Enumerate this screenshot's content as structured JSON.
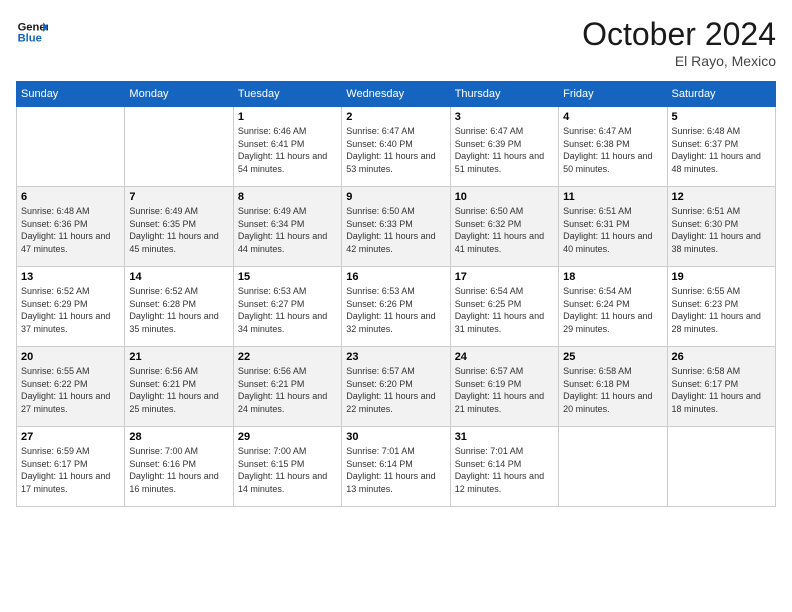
{
  "header": {
    "logo_line1": "General",
    "logo_line2": "Blue",
    "month": "October 2024",
    "location": "El Rayo, Mexico"
  },
  "weekdays": [
    "Sunday",
    "Monday",
    "Tuesday",
    "Wednesday",
    "Thursday",
    "Friday",
    "Saturday"
  ],
  "weeks": [
    [
      {
        "day": "",
        "info": ""
      },
      {
        "day": "",
        "info": ""
      },
      {
        "day": "1",
        "info": "Sunrise: 6:46 AM\nSunset: 6:41 PM\nDaylight: 11 hours and 54 minutes."
      },
      {
        "day": "2",
        "info": "Sunrise: 6:47 AM\nSunset: 6:40 PM\nDaylight: 11 hours and 53 minutes."
      },
      {
        "day": "3",
        "info": "Sunrise: 6:47 AM\nSunset: 6:39 PM\nDaylight: 11 hours and 51 minutes."
      },
      {
        "day": "4",
        "info": "Sunrise: 6:47 AM\nSunset: 6:38 PM\nDaylight: 11 hours and 50 minutes."
      },
      {
        "day": "5",
        "info": "Sunrise: 6:48 AM\nSunset: 6:37 PM\nDaylight: 11 hours and 48 minutes."
      }
    ],
    [
      {
        "day": "6",
        "info": "Sunrise: 6:48 AM\nSunset: 6:36 PM\nDaylight: 11 hours and 47 minutes."
      },
      {
        "day": "7",
        "info": "Sunrise: 6:49 AM\nSunset: 6:35 PM\nDaylight: 11 hours and 45 minutes."
      },
      {
        "day": "8",
        "info": "Sunrise: 6:49 AM\nSunset: 6:34 PM\nDaylight: 11 hours and 44 minutes."
      },
      {
        "day": "9",
        "info": "Sunrise: 6:50 AM\nSunset: 6:33 PM\nDaylight: 11 hours and 42 minutes."
      },
      {
        "day": "10",
        "info": "Sunrise: 6:50 AM\nSunset: 6:32 PM\nDaylight: 11 hours and 41 minutes."
      },
      {
        "day": "11",
        "info": "Sunrise: 6:51 AM\nSunset: 6:31 PM\nDaylight: 11 hours and 40 minutes."
      },
      {
        "day": "12",
        "info": "Sunrise: 6:51 AM\nSunset: 6:30 PM\nDaylight: 11 hours and 38 minutes."
      }
    ],
    [
      {
        "day": "13",
        "info": "Sunrise: 6:52 AM\nSunset: 6:29 PM\nDaylight: 11 hours and 37 minutes."
      },
      {
        "day": "14",
        "info": "Sunrise: 6:52 AM\nSunset: 6:28 PM\nDaylight: 11 hours and 35 minutes."
      },
      {
        "day": "15",
        "info": "Sunrise: 6:53 AM\nSunset: 6:27 PM\nDaylight: 11 hours and 34 minutes."
      },
      {
        "day": "16",
        "info": "Sunrise: 6:53 AM\nSunset: 6:26 PM\nDaylight: 11 hours and 32 minutes."
      },
      {
        "day": "17",
        "info": "Sunrise: 6:54 AM\nSunset: 6:25 PM\nDaylight: 11 hours and 31 minutes."
      },
      {
        "day": "18",
        "info": "Sunrise: 6:54 AM\nSunset: 6:24 PM\nDaylight: 11 hours and 29 minutes."
      },
      {
        "day": "19",
        "info": "Sunrise: 6:55 AM\nSunset: 6:23 PM\nDaylight: 11 hours and 28 minutes."
      }
    ],
    [
      {
        "day": "20",
        "info": "Sunrise: 6:55 AM\nSunset: 6:22 PM\nDaylight: 11 hours and 27 minutes."
      },
      {
        "day": "21",
        "info": "Sunrise: 6:56 AM\nSunset: 6:21 PM\nDaylight: 11 hours and 25 minutes."
      },
      {
        "day": "22",
        "info": "Sunrise: 6:56 AM\nSunset: 6:21 PM\nDaylight: 11 hours and 24 minutes."
      },
      {
        "day": "23",
        "info": "Sunrise: 6:57 AM\nSunset: 6:20 PM\nDaylight: 11 hours and 22 minutes."
      },
      {
        "day": "24",
        "info": "Sunrise: 6:57 AM\nSunset: 6:19 PM\nDaylight: 11 hours and 21 minutes."
      },
      {
        "day": "25",
        "info": "Sunrise: 6:58 AM\nSunset: 6:18 PM\nDaylight: 11 hours and 20 minutes."
      },
      {
        "day": "26",
        "info": "Sunrise: 6:58 AM\nSunset: 6:17 PM\nDaylight: 11 hours and 18 minutes."
      }
    ],
    [
      {
        "day": "27",
        "info": "Sunrise: 6:59 AM\nSunset: 6:17 PM\nDaylight: 11 hours and 17 minutes."
      },
      {
        "day": "28",
        "info": "Sunrise: 7:00 AM\nSunset: 6:16 PM\nDaylight: 11 hours and 16 minutes."
      },
      {
        "day": "29",
        "info": "Sunrise: 7:00 AM\nSunset: 6:15 PM\nDaylight: 11 hours and 14 minutes."
      },
      {
        "day": "30",
        "info": "Sunrise: 7:01 AM\nSunset: 6:14 PM\nDaylight: 11 hours and 13 minutes."
      },
      {
        "day": "31",
        "info": "Sunrise: 7:01 AM\nSunset: 6:14 PM\nDaylight: 11 hours and 12 minutes."
      },
      {
        "day": "",
        "info": ""
      },
      {
        "day": "",
        "info": ""
      }
    ]
  ]
}
